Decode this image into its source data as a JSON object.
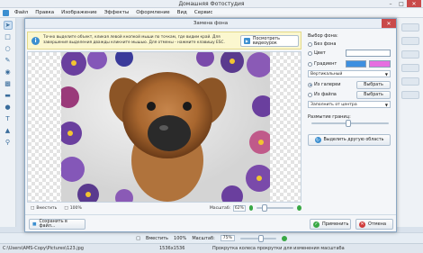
{
  "app": {
    "title": "Домашняя Фотостудия",
    "menu": [
      "Файл",
      "Правка",
      "Изображение",
      "Эффекты",
      "Оформление",
      "Вид",
      "Сервис"
    ]
  },
  "dialog": {
    "title": "Замена фона",
    "hint": "Точно выделите объект, кликая левой кнопкой мыши по точкам, где видим край. Для завершения выделения дважды кликните мышью. Для отмены - нажмите клавишу ESC.",
    "video_button": "Посмотреть видеоурок",
    "canvas_toolbar": {
      "fit_label": "Вместить",
      "zoom100_label": "100%",
      "scale_label": "Масштаб:",
      "scale_value": "62%"
    },
    "panel": {
      "bg_choice_label": "Выбор фона:",
      "no_bg": "Без фона",
      "color": "Цвет",
      "gradient": "Градиент",
      "gradient_direction": "Вертикальный",
      "from_gallery": "Из галереи",
      "from_file": "Из файла",
      "choose": "Выбрать",
      "fill_mode": "Заполнить от центра",
      "blur_label": "Размытие границ:",
      "select_other": "Выделить другую область"
    },
    "colors": {
      "color_swatch": "#ffffff",
      "gradient_start": "#3d8fe0",
      "gradient_end": "#e66ee0"
    },
    "footer": {
      "save_to_file": "Сохранить в файл...",
      "apply": "Применить",
      "cancel": "Отмена"
    }
  },
  "bottom_toolbar": {
    "fit": "Вместить",
    "zoom100": "100%",
    "scale_label": "Масштаб:",
    "scale_value": "75%"
  },
  "status": {
    "path": "C:\\Users\\AMS-Copy\\Pictures\\123.jpg",
    "size": "1536x1536",
    "hint": "Прокрутка колеса прокрутки для изменения масштаба"
  }
}
